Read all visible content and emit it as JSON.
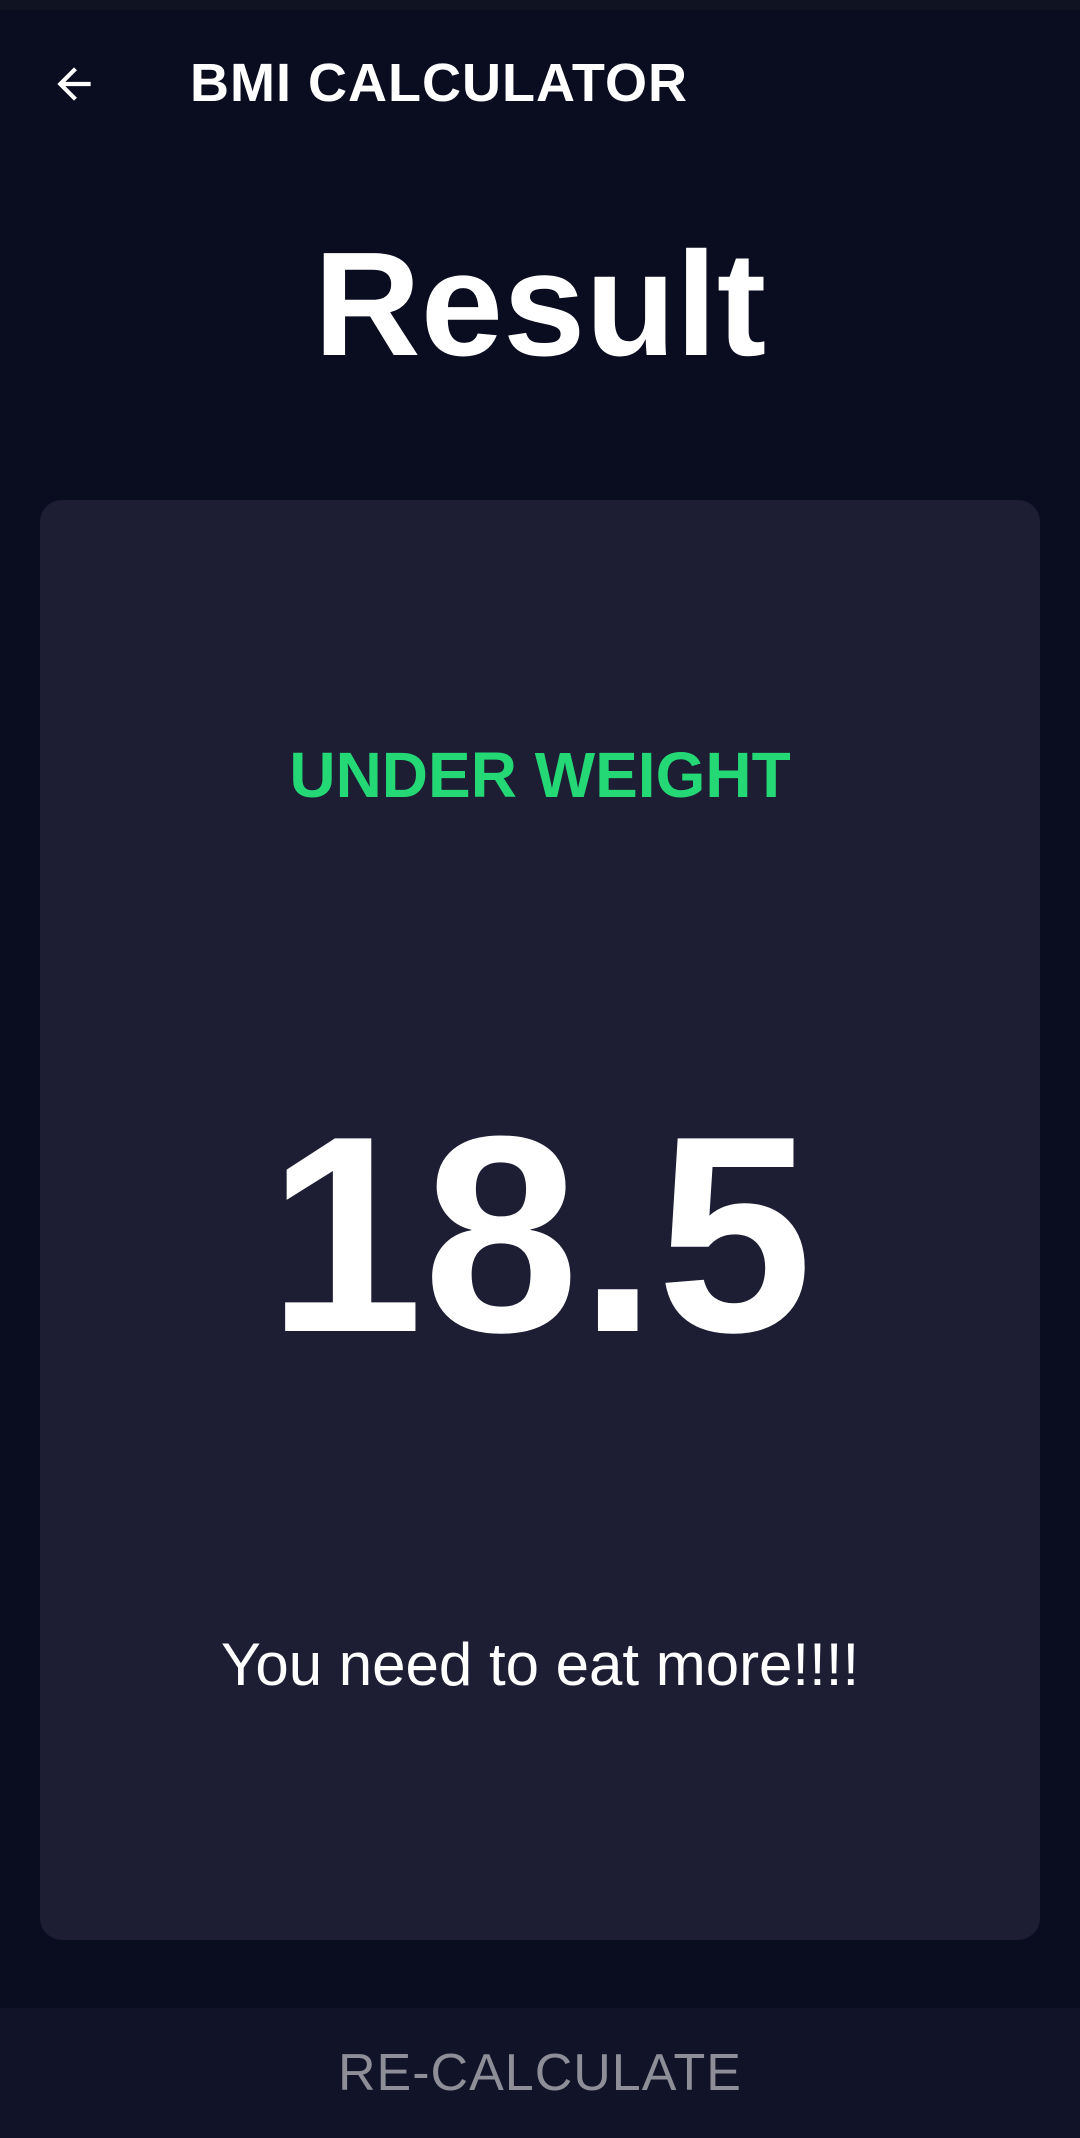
{
  "app_bar": {
    "title": "BMI CALCULATOR",
    "back_icon": "arrow-left-icon"
  },
  "page": {
    "title": "Result"
  },
  "result": {
    "status": "UNDER WEIGHT",
    "bmi": "18.5",
    "advice": "You need to eat more!!!!"
  },
  "footer": {
    "button_label": "RE-CALCULATE"
  },
  "colors": {
    "background": "#0a0d1f",
    "card": "#1d1e33",
    "status_green": "#24d876",
    "footer": "#111328",
    "footer_text": "#8d8e98"
  }
}
